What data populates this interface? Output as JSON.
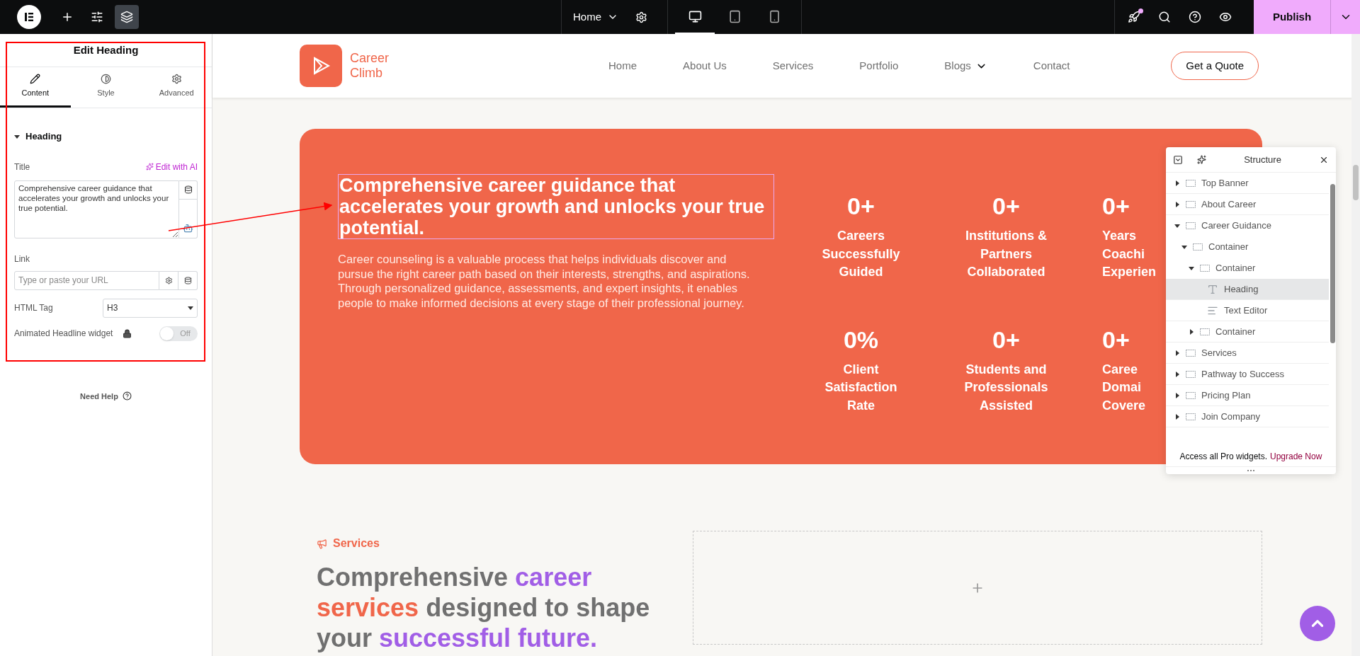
{
  "topbar": {
    "tools": [
      {
        "selected": false
      },
      {
        "selected": false
      },
      {
        "selected": true
      }
    ],
    "page": "Home",
    "devices": [
      {
        "selected": true
      },
      {
        "selected": false
      },
      {
        "selected": false
      }
    ],
    "publish": "Publish"
  },
  "panel": {
    "title": "Edit Heading",
    "tabs": [
      {
        "label": "Content",
        "selected": true
      },
      {
        "label": "Style",
        "selected": false
      },
      {
        "label": "Advanced",
        "selected": false
      }
    ],
    "section": {
      "label": "Heading",
      "expanded": true
    },
    "title_label": "Title",
    "ai_link": "Edit with AI",
    "title_value": "Comprehensive career guidance that accelerates your growth and unlocks your true potential.",
    "link_label": "Link",
    "link_placeholder": "Type or paste your URL",
    "tag_label": "HTML Tag",
    "tag_value": "H3",
    "animated_label": "Animated Headline widget",
    "toggle": {
      "on": false,
      "label": "Off"
    },
    "help": "Need Help"
  },
  "site": {
    "logo": [
      "Career",
      "Climb"
    ],
    "nav": [
      {
        "label": "Home",
        "dropdown": false
      },
      {
        "label": "About Us",
        "dropdown": false
      },
      {
        "label": "Services",
        "dropdown": false
      },
      {
        "label": "Portfolio",
        "dropdown": false
      },
      {
        "label": "Blogs",
        "dropdown": true
      },
      {
        "label": "Contact",
        "dropdown": false
      }
    ],
    "cta": "Get a Quote"
  },
  "hero": {
    "heading": "Comprehensive career guidance that accelerates your growth and unlocks your true potential.",
    "paragraph": "Career counseling is a valuable process that helps individuals discover and pursue the right career path based on their interests, strengths, and aspirations. Through personalized guidance, assessments, and expert insights, it enables people to make informed decisions at every stage of their professional journey.",
    "stats": [
      {
        "value": "0+",
        "lines": [
          "Careers",
          "Successfully",
          "Guided"
        ]
      },
      {
        "value": "0+",
        "lines": [
          "Institutions &",
          "Partners",
          "Collaborated"
        ]
      },
      {
        "value": "0+",
        "lines": [
          "Years",
          "Coachi",
          "Experien"
        ]
      },
      {
        "value": "0%",
        "lines": [
          "Client",
          "Satisfaction",
          "Rate"
        ]
      },
      {
        "value": "0+",
        "lines": [
          "Students and",
          "Professionals",
          "Assisted"
        ]
      },
      {
        "value": "0+",
        "lines": [
          "Caree",
          "Domai",
          "Covere"
        ]
      }
    ]
  },
  "structure": {
    "title": "Structure",
    "items": [
      {
        "label": "Top Banner",
        "kind": "container",
        "expanded": false,
        "selected": false
      },
      {
        "label": "About Career",
        "kind": "container",
        "expanded": false,
        "selected": false
      },
      {
        "label": "Career Guidance",
        "kind": "container",
        "expanded": true,
        "selected": false,
        "children": [
          {
            "label": "Container",
            "kind": "container",
            "expanded": true,
            "selected": false,
            "children": [
              {
                "label": "Container",
                "kind": "container",
                "expanded": true,
                "selected": false,
                "children": [
                  {
                    "label": "Heading",
                    "kind": "heading",
                    "selected": true
                  },
                  {
                    "label": "Text Editor",
                    "kind": "text",
                    "selected": false
                  }
                ]
              },
              {
                "label": "Container",
                "kind": "container",
                "expanded": false,
                "selected": false
              }
            ]
          }
        ]
      },
      {
        "label": "Services",
        "kind": "container",
        "expanded": false,
        "selected": false
      },
      {
        "label": "Pathway to Success",
        "kind": "container",
        "expanded": false,
        "selected": false
      },
      {
        "label": "Pricing Plan",
        "kind": "container",
        "expanded": false,
        "selected": false
      },
      {
        "label": "Join Company",
        "kind": "container",
        "expanded": false,
        "selected": false
      }
    ],
    "footer": "Access all Pro widgets.",
    "footer_link": "Upgrade Now"
  },
  "services": {
    "eyebrow": "Services",
    "heading": [
      {
        "text": "Comprehensive ",
        "kind": "plain"
      },
      {
        "text": "career ",
        "kind": "purple"
      },
      {
        "text": "services",
        "kind": "orange"
      },
      {
        "text": " designed to shape your ",
        "kind": "plain"
      },
      {
        "text": "successful future.",
        "kind": "purple"
      }
    ]
  }
}
